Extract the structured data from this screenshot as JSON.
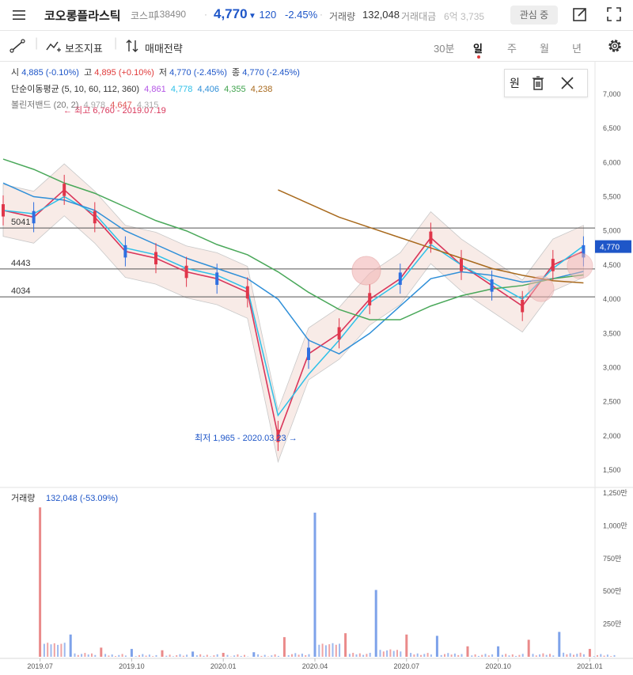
{
  "header": {
    "stock_name": "코오롱플라스틱",
    "market": "코스피",
    "code": "138490",
    "price": "4,770",
    "change_arrow": "▼",
    "change": "120",
    "change_pct": "-2.45%",
    "volume_label": "거래량",
    "volume": "132,048",
    "amount_label": "거래대금",
    "amount": "6억 3,735",
    "watch_button": "관심 중"
  },
  "toolbar": {
    "indicators": "보조지표",
    "strategy": "매매전략",
    "periods": [
      "30분",
      "일",
      "주",
      "월",
      "년"
    ],
    "selected_period": "일"
  },
  "legend": {
    "ohlc": {
      "open_label": "시",
      "open": "4,885 (-0.10%)",
      "high_label": "고",
      "high": "4,895 (+0.10%)",
      "low_label": "저",
      "low": "4,770 (-2.45%)",
      "close_label": "종",
      "close": "4,770 (-2.45%)"
    },
    "sma": {
      "label": "단순이동평균 (5, 10, 60, 112, 360)",
      "values": [
        "4,861",
        "4,778",
        "4,406",
        "4,355",
        "4,238"
      ],
      "colors": [
        "#b455e6",
        "#2ec0e8",
        "#2f8fd8",
        "#3fa34d",
        "#a8691c"
      ]
    },
    "bollinger": {
      "label": "볼린저밴드 (20, 2)",
      "values": [
        "4,978",
        "4,647",
        "4,315"
      ]
    }
  },
  "overlay": {
    "unit_label": "원"
  },
  "annotations": {
    "high": "← 최고 6,760 - 2019.07.19",
    "low": "최저 1,965 - 2020.03.23 →"
  },
  "chart_data": [
    {
      "type": "line",
      "title": "",
      "price_axis_ticks": [
        "7,000",
        "6,500",
        "6,000",
        "5,500",
        "5,000",
        "4,500",
        "4,000",
        "3,500",
        "3,000",
        "2,500",
        "2,000",
        "1,500"
      ],
      "ylim": [
        1200,
        7600
      ],
      "current_price_tag": "4,770",
      "horizontal_levels": [
        {
          "label": "5041",
          "value": 5041
        },
        {
          "label": "4443",
          "value": 4443
        },
        {
          "label": "4034",
          "value": 4034
        }
      ],
      "x_ticks": [
        "2019.07",
        "2019.10",
        "2020.01",
        "2020.04",
        "2020.07",
        "2020.10",
        "2021.01"
      ],
      "x": [
        "2019.06",
        "2019.07",
        "2019.08",
        "2019.09",
        "2019.10",
        "2019.11",
        "2019.12",
        "2020.01",
        "2020.02",
        "2020.03",
        "2020.04",
        "2020.05",
        "2020.06",
        "2020.07",
        "2020.08",
        "2020.09",
        "2020.10",
        "2020.11",
        "2020.12",
        "2021.01"
      ],
      "series": [
        {
          "values": [
            5300,
            5200,
            5600,
            5200,
            4700,
            4600,
            4400,
            4300,
            4100,
            2000,
            3200,
            3500,
            4000,
            4300,
            4900,
            4500,
            4200,
            3900,
            4500,
            4700
          ]
        },
        {
          "values": [
            5300,
            5250,
            5500,
            5250,
            4750,
            4650,
            4450,
            4350,
            4150,
            2300,
            2900,
            3400,
            3950,
            4250,
            4800,
            4500,
            4250,
            4000,
            4450,
            4780
          ]
        },
        {
          "values": [
            5700,
            5500,
            5450,
            5300,
            5000,
            4800,
            4600,
            4450,
            4300,
            4000,
            3400,
            3200,
            3500,
            3900,
            4300,
            4400,
            4350,
            4250,
            4300,
            4406
          ]
        },
        {
          "values": [
            6050,
            5900,
            5700,
            5550,
            5350,
            5150,
            5000,
            4800,
            4650,
            4400,
            4100,
            3850,
            3700,
            3700,
            3900,
            4050,
            4150,
            4200,
            4300,
            4355
          ]
        },
        {
          "values": [
            null,
            null,
            null,
            null,
            null,
            null,
            null,
            null,
            null,
            5600,
            5400,
            5200,
            5050,
            4900,
            4750,
            4600,
            4450,
            4350,
            4270,
            4238
          ]
        }
      ]
    },
    {
      "type": "bar",
      "title": "거래량",
      "current_value": "132,048 (-53.09%)",
      "axis_ticks": [
        "1,250만",
        "1,000만",
        "750만",
        "500만",
        "250만"
      ],
      "ylim": [
        0,
        12500000
      ],
      "x": [
        "2019.07",
        "2019.08",
        "2019.09",
        "2019.10",
        "2019.11",
        "2019.12",
        "2020.01",
        "2020.02",
        "2020.03",
        "2020.04",
        "2020.05",
        "2020.06",
        "2020.07",
        "2020.08",
        "2020.09",
        "2020.10",
        "2020.11",
        "2020.12",
        "2021.01"
      ],
      "values": [
        11400000,
        1700000,
        700000,
        600000,
        500000,
        400000,
        300000,
        350000,
        1500000,
        11000000,
        1800000,
        5100000,
        1700000,
        1600000,
        800000,
        800000,
        1300000,
        1900000,
        600000
      ]
    }
  ]
}
